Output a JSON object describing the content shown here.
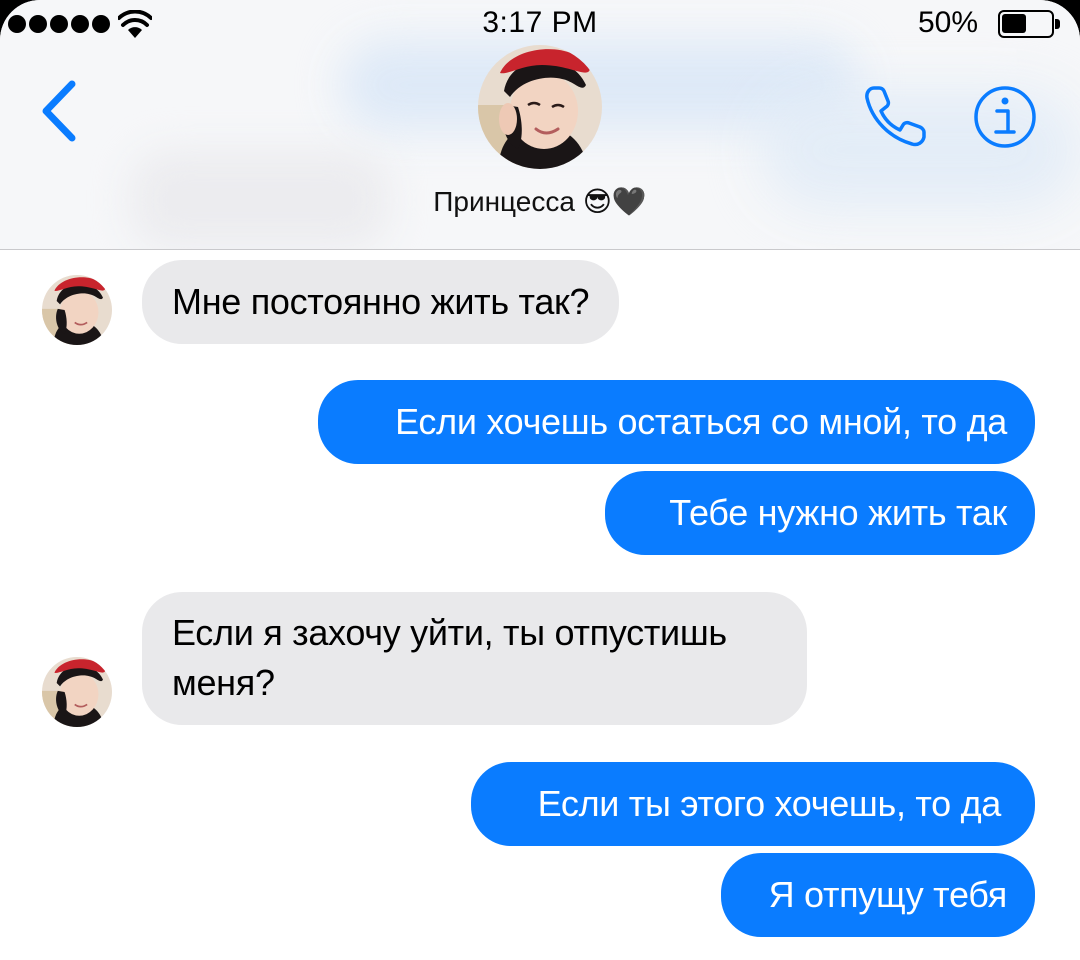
{
  "status_bar": {
    "time": "3:17 PM",
    "battery_percent": "50%",
    "battery_level": 0.5,
    "signal_bars": 5,
    "wifi_icon": "wifi-icon"
  },
  "header": {
    "contact_name": "Принцесса 😎🖤",
    "back_icon": "chevron-left-icon",
    "call_icon": "phone-icon",
    "info_icon": "info-icon"
  },
  "messages": [
    {
      "direction": "incoming",
      "text": "Мне постоянно жить так?"
    },
    {
      "direction": "outgoing",
      "text": "Если хочешь остаться со мной, то да"
    },
    {
      "direction": "outgoing",
      "text": "Тебе нужно жить так"
    },
    {
      "direction": "incoming",
      "text_line1": "Если я захочу уйти, ты отпустишь",
      "text_line2": "меня?"
    },
    {
      "direction": "outgoing",
      "text": "Если ты этого хочешь, то да"
    },
    {
      "direction": "outgoing",
      "text": "Я отпущу тебя"
    }
  ],
  "colors": {
    "accent": "#0a7cff",
    "incoming_bubble": "#e9e9eb",
    "outgoing_bubble": "#0a7cff"
  }
}
